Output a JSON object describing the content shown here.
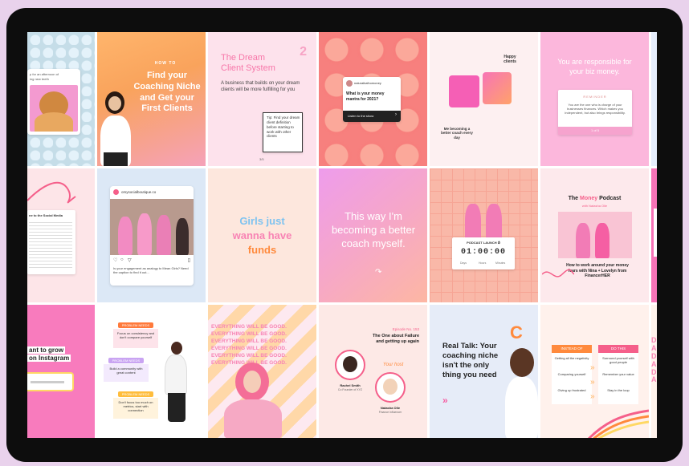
{
  "row1": {
    "t0": {
      "line1": "p for an afternoon of",
      "line2": "ing new teeth"
    },
    "t1": {
      "eyebrow": "HOW TO",
      "title": "Find your Coaching Niche and Get your First Clients"
    },
    "t2": {
      "title": "The Dream Client System",
      "number": "2",
      "body": "A business that builds on your dream clients will be more fulfilling for you",
      "tip": "Tip: Find your dream client definition before starting to work with other clients",
      "page": "3/5"
    },
    "t3": {
      "handle": "naturalkalhomoney",
      "question": "What is your money mantra for 2021?",
      "button": "Listen to the show"
    },
    "t4": {
      "top": "Happy clients",
      "bottom": "Me becoming a better coach every day"
    },
    "t5": {
      "title": "You are responsible for your biz money.",
      "card_head": "REMINDER",
      "card_body": "You are the one who is charge of your businesses finances. Which makes you independent, but also brings responsibility.",
      "foot": "1 of 5"
    }
  },
  "row2": {
    "t0": {
      "head": "ne to the Social Media"
    },
    "t1": {
      "handle": "omysocialboutique.co",
      "caption": "Is your engagement as analogy to Mean Girls? Need the caption to find it out..."
    },
    "t2": {
      "line1": "Girls just",
      "line2": "wanna have",
      "line3": "funds"
    },
    "t3": {
      "text": "This way I'm becoming a better coach myself."
    },
    "t4": {
      "title": "PODCAST LAUNCH ⏱",
      "timer": "01:00:00",
      "units": [
        "Days",
        "Hours",
        "Minutes"
      ]
    },
    "t5": {
      "title_pre": "The ",
      "title_accent": "Money",
      "title_post": " Podcast",
      "sub": "with Natasha Olle",
      "caption": "How to work around your money fears with Nina + Lovelyn from FinancerHER"
    },
    "t6": {
      "text": "Got hap"
    }
  },
  "row3": {
    "t0": {
      "line1": "ant to grow",
      "line2": "on Instagram"
    },
    "t1": {
      "l1": "PROBLEM NEEDS",
      "l1b": "Focus on consistency and don't compare yourself",
      "l2": "PROBLEM NEEDS",
      "l2b": "Build a community with great content",
      "l3": "PROBLEM NEEDS",
      "l3b": "Don't focus too much on metrics, start with connection"
    },
    "t2": {
      "text": "EVERYTHING WILL BE GOOD."
    },
    "t3": {
      "eyebrow": "Episode No. 153",
      "title": "The One about Failure and getting up again",
      "guest1": "Rachel Smith",
      "guest1_role": "Co Founder of XYZ",
      "host_label": "Your host",
      "guest2": "Natasha Olle",
      "guest2_role": "Finance influencer"
    },
    "t4": {
      "title": "Real Talk: Your coaching niche isn't the only thing you need",
      "arrow": "»",
      "logo": "C"
    },
    "t5": {
      "left_head": "INSTEAD OF",
      "right_head": "DO THIS",
      "left": [
        "Getting all the negativity",
        "Comparing yourself",
        "Giving up frustrated"
      ],
      "right": [
        "Surround yourself with good people",
        "Remember your value",
        "Stay in the loop"
      ]
    },
    "t6": {
      "letters": "DA DA DA"
    }
  },
  "colors": {
    "pink": "#f75da0",
    "coral": "#f86c83",
    "peach": "#fcd0c3",
    "lavender": "#e6b8f0",
    "orange": "#ffb15b"
  }
}
